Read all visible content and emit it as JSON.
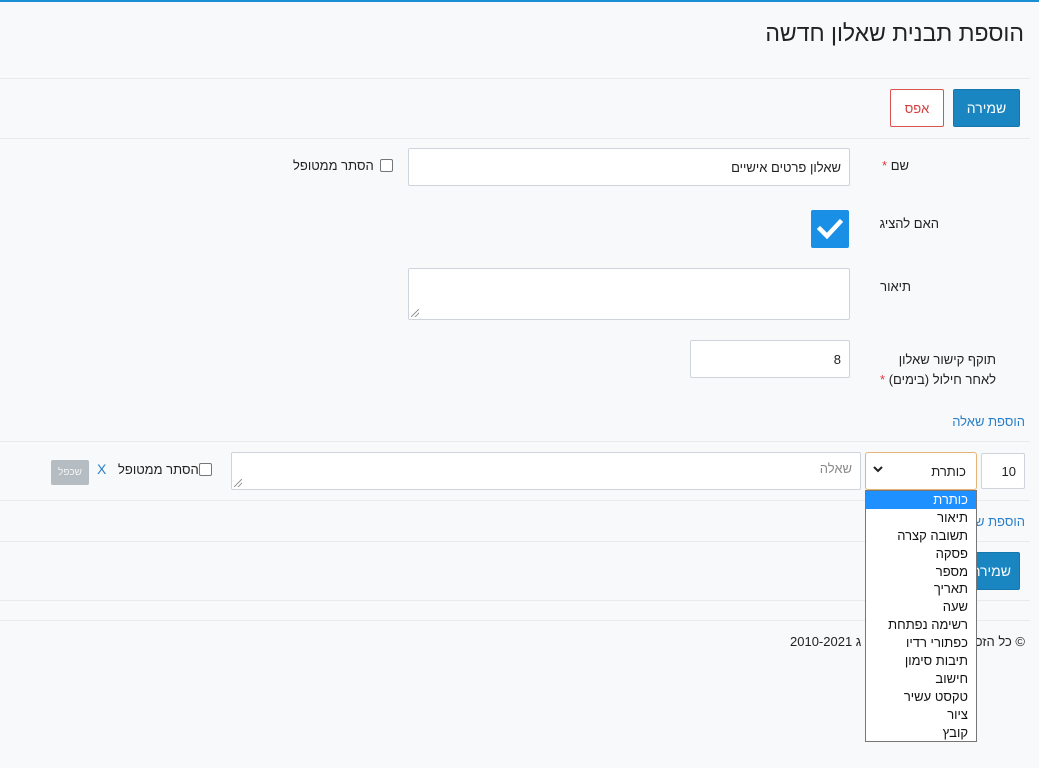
{
  "page": {
    "title": "הוספת תבנית שאלון חדשה"
  },
  "toolbar": {
    "save_label": "שמירה",
    "reset_label": "אפס"
  },
  "form": {
    "name": {
      "label": "שם",
      "required_mark": "*",
      "value": "שאלון פרטים אישיים",
      "hide_label": "הסתר ממטופל",
      "hide_checked": false
    },
    "show": {
      "label": "האם להציג",
      "checked": true
    },
    "description": {
      "label": "תיאור",
      "value": ""
    },
    "validity": {
      "label_line1": "תוקף קישור שאלון",
      "label_line2": "לאחר חילול (בימים)",
      "required_mark": "*",
      "value": "8"
    }
  },
  "add_question_label": "הוספת שאלה",
  "add_question_label_bottom": "הוספת ש",
  "question": {
    "order": "10",
    "type_selected": "כותרת",
    "placeholder": "שאלה",
    "hide_label": "הסתר ממטופל",
    "delete_label": "X",
    "duplicate_label": "שכפל"
  },
  "type_options": [
    "כותרת",
    "תיאור",
    "תשובה קצרה",
    "פסקה",
    "מספר",
    "תאריך",
    "שעה",
    "רשימה נפתחת",
    "כפתורי רדיו",
    "תיבות סימון",
    "חישוב",
    "טקסט עשיר",
    "ציור",
    "קובץ"
  ],
  "bottom_save_label": "שמירה",
  "footer": {
    "text": "© כל הזכ",
    "years": "2010-2021",
    "fragment": "ג"
  },
  "colors": {
    "primary": "#1986c2",
    "danger": "#d9534f",
    "link": "#2a7fc9",
    "check": "#1a8fe6"
  }
}
